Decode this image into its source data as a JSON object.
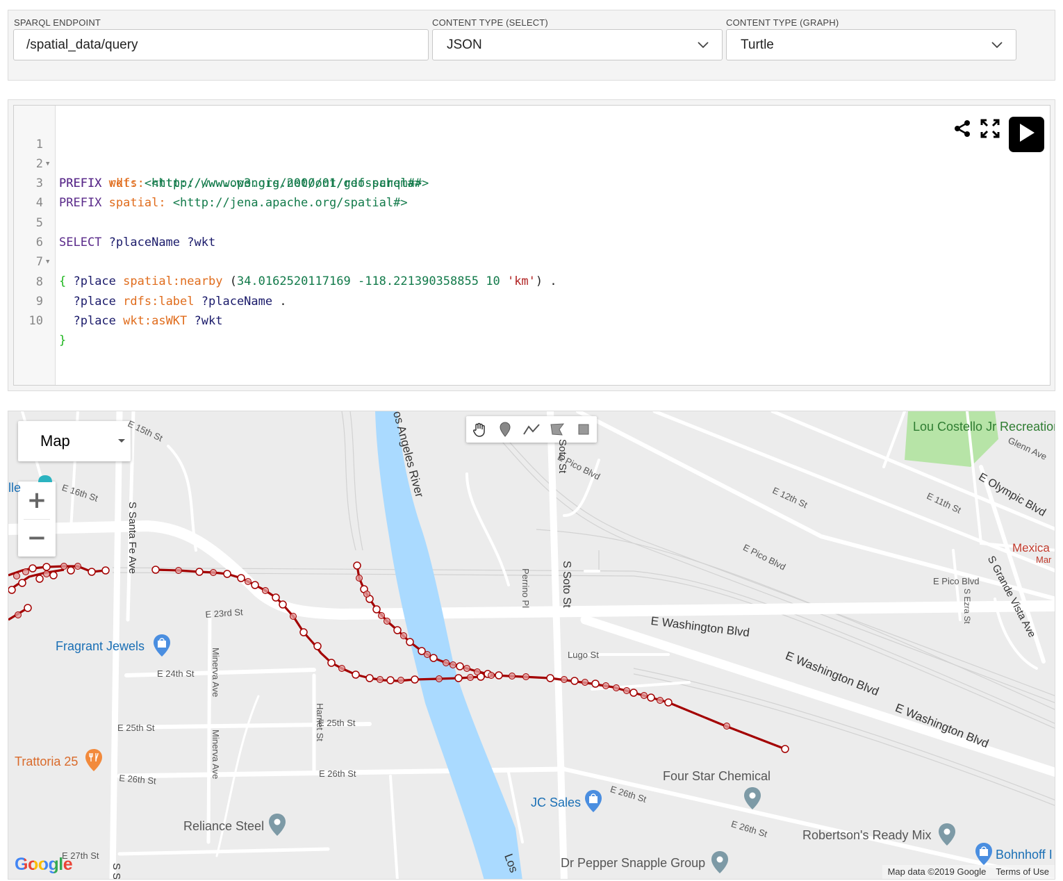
{
  "config": {
    "endpoint": {
      "label": "SPARQL ENDPOINT",
      "value": "/spatial_data/query"
    },
    "content_type_select": {
      "label": "CONTENT TYPE (SELECT)",
      "value": "JSON"
    },
    "content_type_graph": {
      "label": "CONTENT TYPE (GRAPH)",
      "value": "Turtle"
    }
  },
  "editor": {
    "line_numbers": [
      "1",
      "2",
      "3",
      "4",
      "5",
      "6",
      "7",
      "8",
      "9",
      "10"
    ],
    "line1": {
      "kw": "PREFIX",
      "pfx": "rdfs:",
      "iri": "<http://www.w3.org/2000/01/rdf-schema#>"
    },
    "line2": {
      "kw": "PREFIX",
      "pfx": "wkt:",
      "iri": "<http://www.opengis.net/ont/geosparql#>"
    },
    "line3": {
      "kw": "PREFIX",
      "pfx": "spatial:",
      "iri": "<http://jena.apache.org/spatial#>"
    },
    "line5": {
      "kw": "SELECT",
      "vars": "?placeName ?wkt"
    },
    "line6": {
      "brace": "{"
    },
    "line7": {
      "subj": "?place",
      "pred": "spatial:nearby",
      "open": "(",
      "lat": "34.0162520117169",
      "lon": "-118.221390358855",
      "radius": "10",
      "unit": "'km'",
      "close": ")",
      "end": "."
    },
    "line8": {
      "subj": "?place",
      "pred": "rdfs:label",
      "obj": "?placeName",
      "end": "."
    },
    "line9": {
      "subj": "?place",
      "pred": "wkt:asWKT",
      "obj": "?wkt"
    },
    "line10": {
      "brace": "}"
    },
    "icons": [
      "share-icon",
      "fullscreen-icon",
      "play-icon"
    ]
  },
  "map": {
    "map_type": "Map",
    "zoom_in": "+",
    "zoom_out": "−",
    "draw_tools": [
      "hand-icon",
      "marker-icon",
      "polyline-icon",
      "polygon-icon",
      "rectangle-icon"
    ],
    "places": {
      "lou_costello": "Lou Costello Jr Recreation Center",
      "fragrant_jewels": "Fragrant Jewels",
      "trattoria": "Trattoria 25",
      "reliance_steel": "Reliance Steel",
      "jc_sales": "JC Sales",
      "four_star": "Four Star Chemical",
      "robertsons": "Robertson's Ready Mix",
      "dr_pepper": "Dr Pepper Snapple Group",
      "bohnhoff": "Bohnhoff I",
      "mexica": "Mexica",
      "mexica_sub": "Mar",
      "partial_left": "lle"
    },
    "streets": {
      "e15th": "E 15th St",
      "e16th": "E 16th St",
      "santa_fe": "S Santa Fe Ave",
      "e23rd": "E 23rd St",
      "minerva1": "Minerva Ave",
      "minerva2": "Minerva Ave",
      "e24th": "E 24th St",
      "e25th_a": "E 25th St",
      "e25th_b": "E 25th St",
      "harriet": "Harriet St",
      "e26th_a": "E 26th St",
      "e26th_b": "E 26th St",
      "e26th_c": "E 26th St",
      "e26th_d": "E 26th St",
      "e27th": "E 27th St",
      "river": "os Angeles River",
      "river2": "Los",
      "soto1": "Soto St",
      "soto2": "S Soto St",
      "perrino": "Perrino Pl",
      "e_pico1": "E Pico Blvd",
      "e_pico2": "E Pico Blvd",
      "e_pico3": "E Pico Blvd",
      "e12th": "E 12th St",
      "e11th": "E 11th St",
      "e_olympic": "E Olympic Blvd",
      "glenn": "Glenn Ave",
      "grande_vista": "S Grande Vista Ave",
      "ezra": "S Ezra St",
      "lugo": "Lugo St",
      "wash1": "E Washington Blvd",
      "wash2": "E Washington Blvd",
      "wash3": "E Washington Blvd",
      "ss": "S S"
    },
    "google_logo": "Google",
    "attribution": "Map data ©2019 Google",
    "terms": "Terms of Use"
  },
  "colors": {
    "route": "#a30000",
    "river": "#aadaff",
    "park": "#b7e4a7",
    "play_button": "#000000"
  }
}
